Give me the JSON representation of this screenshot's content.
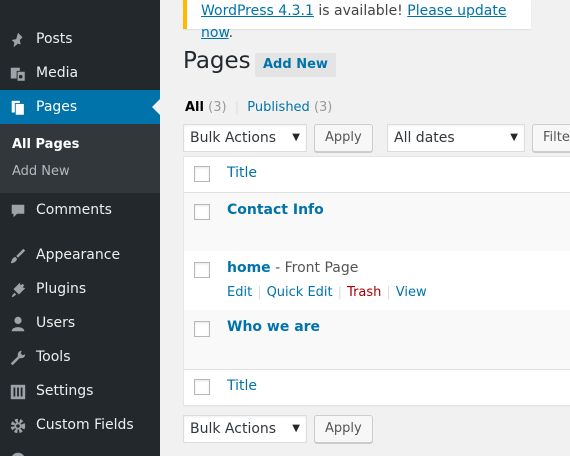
{
  "sidebar": {
    "items": [
      {
        "label": "Posts",
        "icon": "pushpin-icon"
      },
      {
        "label": "Media",
        "icon": "media-icon"
      },
      {
        "label": "Pages",
        "icon": "pages-icon",
        "active": true
      },
      {
        "label": "Comments",
        "icon": "comment-icon"
      },
      {
        "label": "Appearance",
        "icon": "paintbrush-icon"
      },
      {
        "label": "Plugins",
        "icon": "plugin-icon"
      },
      {
        "label": "Users",
        "icon": "user-icon"
      },
      {
        "label": "Tools",
        "icon": "wrench-icon"
      },
      {
        "label": "Settings",
        "icon": "settings-icon"
      },
      {
        "label": "Custom Fields",
        "icon": "gear-icon"
      }
    ],
    "submenu": [
      "All Pages",
      "Add New"
    ]
  },
  "notice": {
    "version_link": "WordPress 4.3.1",
    "middle": " is available! ",
    "update_link": "Please update now",
    "end": "."
  },
  "heading": {
    "title": "Pages",
    "add_new": "Add New"
  },
  "views": {
    "all_label": "All",
    "all_count": "(3)",
    "sep": "|",
    "published_label": "Published",
    "published_count": "(3)"
  },
  "filters": {
    "bulk_actions": "Bulk Actions",
    "apply": "Apply",
    "dates": "All dates",
    "filter": "Filter"
  },
  "table": {
    "column_title": "Title",
    "rows": [
      {
        "title": "Contact Info",
        "state": ""
      },
      {
        "title": "home",
        "state": " - Front Page"
      },
      {
        "title": "Who we are",
        "state": ""
      }
    ],
    "row_actions": [
      "Edit",
      "Quick Edit",
      "Trash",
      "View"
    ]
  },
  "colors": {
    "sidebar": "#23282d",
    "active": "#0073aa",
    "link": "#0073aa",
    "notice_border": "#ffb900",
    "trash": "#a00"
  }
}
